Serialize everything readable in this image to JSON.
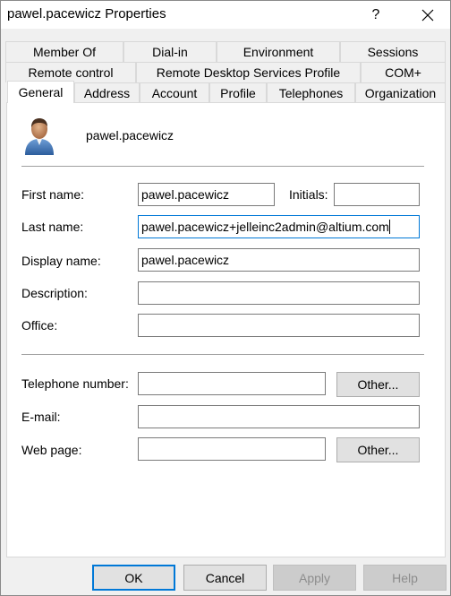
{
  "window": {
    "title": "pawel.pacewicz Properties",
    "help_label": "?",
    "close_label": "✕"
  },
  "tabs": {
    "row1": [
      "Member Of",
      "Dial-in",
      "Environment",
      "Sessions"
    ],
    "row2": [
      "Remote control",
      "Remote Desktop Services Profile",
      "COM+"
    ],
    "row3": [
      "General",
      "Address",
      "Account",
      "Profile",
      "Telephones",
      "Organization"
    ],
    "active": "General"
  },
  "general": {
    "user_name": "pawel.pacewicz",
    "user_icon": "user-icon",
    "first_name_label": "First name:",
    "first_name_value": "pawel.pacewicz",
    "initials_label": "Initials:",
    "initials_value": "",
    "last_name_label": "Last name:",
    "last_name_value": "pawel.pacewicz+jelleinc2admin@altium.com",
    "display_name_label": "Display name:",
    "display_name_value": "pawel.pacewicz",
    "description_label": "Description:",
    "description_value": "",
    "office_label": "Office:",
    "office_value": "",
    "telephone_label": "Telephone number:",
    "telephone_value": "",
    "email_label": "E-mail:",
    "email_value": "",
    "webpage_label": "Web page:",
    "webpage_value": "",
    "other_label": "Other..."
  },
  "footer": {
    "ok_label": "OK",
    "cancel_label": "Cancel",
    "apply_label": "Apply",
    "help_label": "Help"
  },
  "colors": {
    "focus": "#0078d7",
    "dialog_bg": "#f0f0f0"
  }
}
